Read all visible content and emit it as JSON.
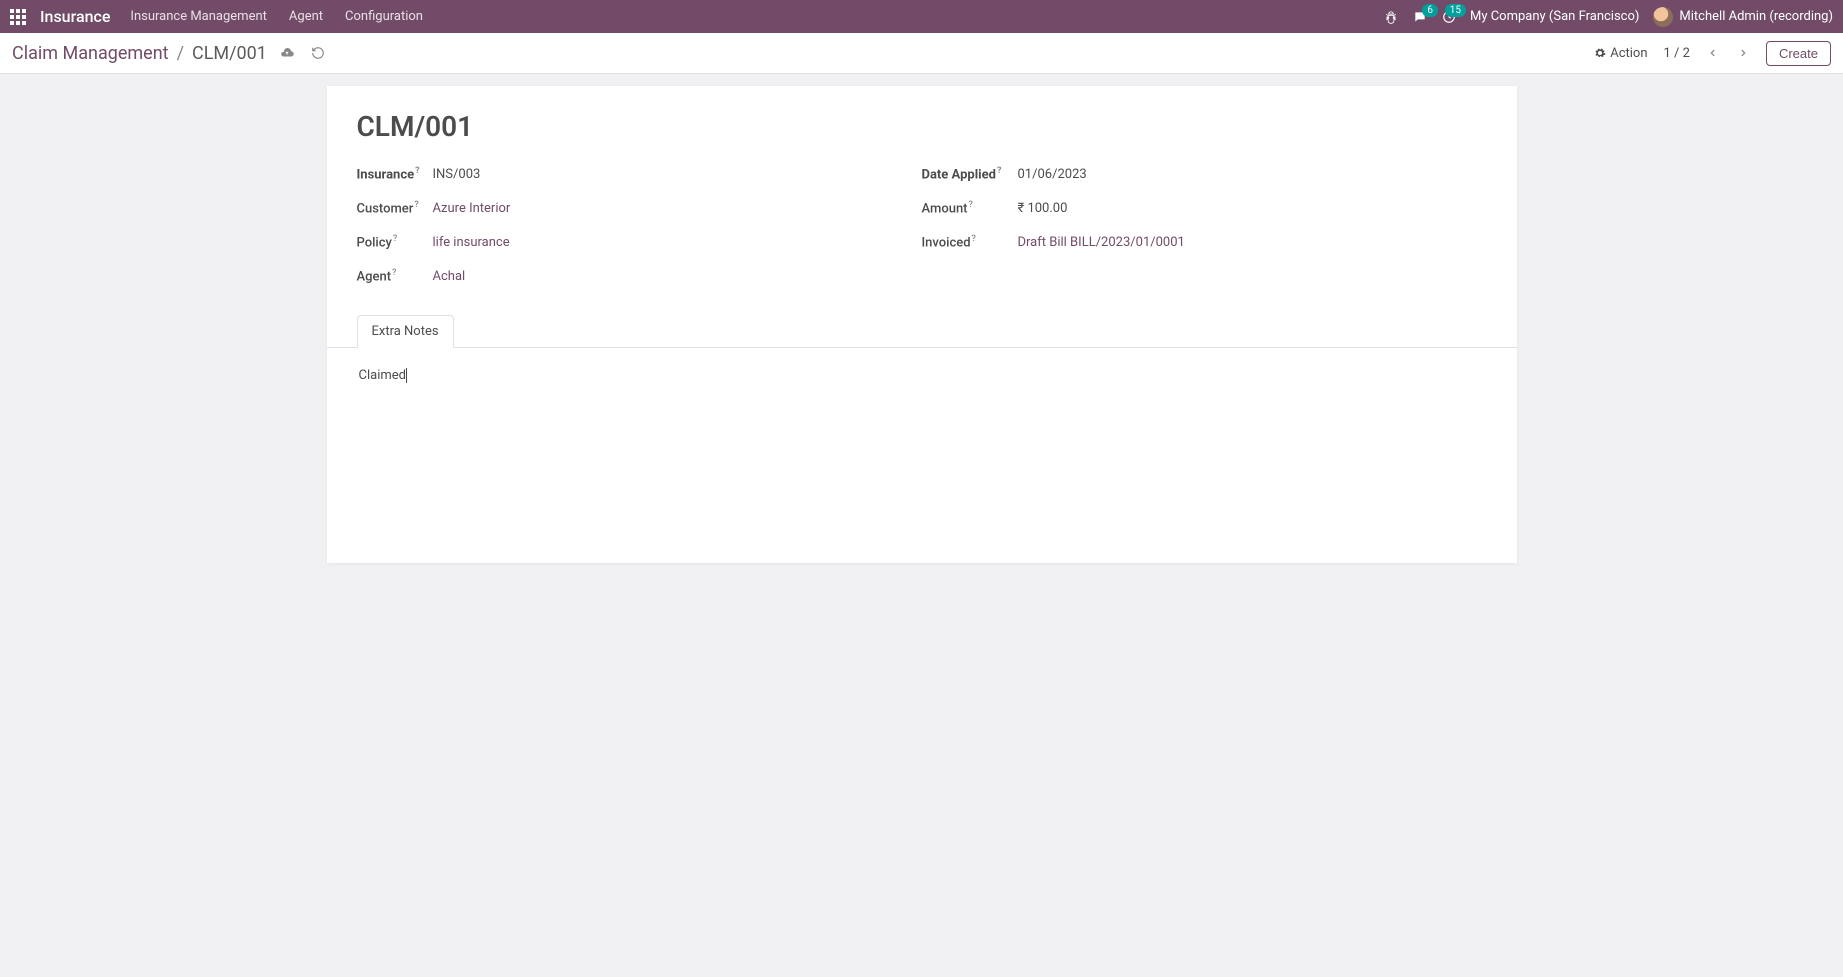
{
  "topnav": {
    "brand": "Insurance",
    "items": [
      "Insurance Management",
      "Agent",
      "Configuration"
    ],
    "chat_badge": "6",
    "activity_badge": "15",
    "company": "My Company (San Francisco)",
    "user": "Mitchell Admin (recording)"
  },
  "breadcrumb": {
    "root": "Claim Management",
    "current": "CLM/001"
  },
  "subbar": {
    "action_label": "Action",
    "pager": "1 / 2",
    "create_label": "Create"
  },
  "record": {
    "title": "CLM/001",
    "left": {
      "insurance_label": "Insurance",
      "insurance_value": "INS/003",
      "customer_label": "Customer",
      "customer_value": "Azure Interior",
      "policy_label": "Policy",
      "policy_value": "life insurance",
      "agent_label": "Agent",
      "agent_value": "Achal"
    },
    "right": {
      "date_label": "Date Applied",
      "date_value": "01/06/2023",
      "amount_label": "Amount",
      "amount_value": "₹ 100.00",
      "invoiced_label": "Invoiced",
      "invoiced_value": "Draft Bill BILL/2023/01/0001"
    }
  },
  "tabs": {
    "extra_notes_label": "Extra Notes",
    "notes_text": "Claimed"
  }
}
